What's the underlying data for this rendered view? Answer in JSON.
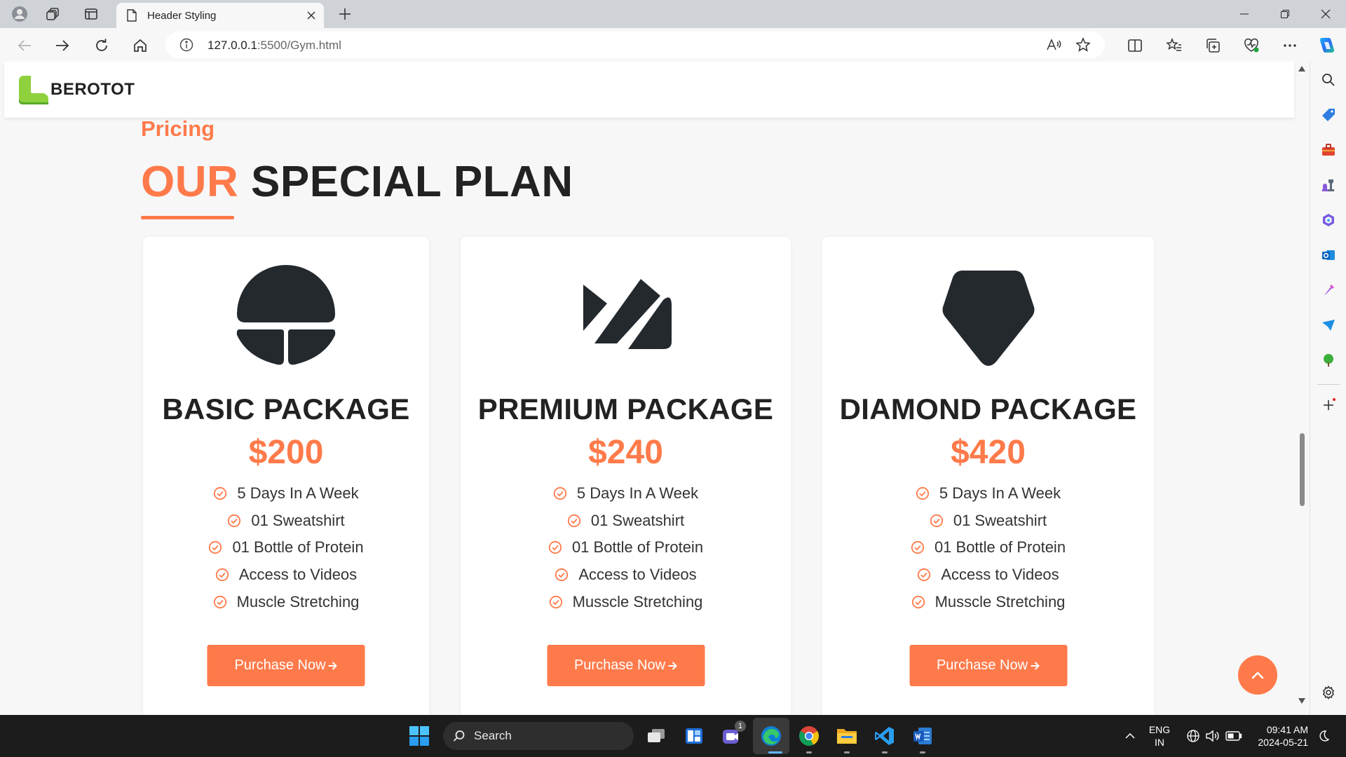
{
  "browser": {
    "tab_title": "Header Styling",
    "url_host": "127.0.0.1",
    "url_path": ":5500/Gym.html"
  },
  "site": {
    "logo_text": "BEROTOT",
    "section_subtitle": "Pricing",
    "section_title_accent": "OUR",
    "section_title_rest": "SPECIAL PLAN"
  },
  "plans": [
    {
      "name": "BASIC PACKAGE",
      "price": "$200",
      "icon": "basic-plan-icon",
      "features": [
        "5 Days In A Week",
        "01 Sweatshirt",
        "01 Bottle of Protein",
        "Access to Videos",
        "Muscle Stretching"
      ],
      "button": "Purchase Now"
    },
    {
      "name": "PREMIUM PACKAGE",
      "price": "$240",
      "icon": "premium-plan-icon",
      "features": [
        "5 Days In A Week",
        "01 Sweatshirt",
        "01 Bottle of Protein",
        "Access to Videos",
        "Musscle Stretching"
      ],
      "button": "Purchase Now"
    },
    {
      "name": "DIAMOND PACKAGE",
      "price": "$420",
      "icon": "diamond-plan-icon",
      "features": [
        "5 Days In A Week",
        "01 Sweatshirt",
        "01 Bottle of Protein",
        "Access to Videos",
        "Musscle Stretching"
      ],
      "button": "Purchase Now"
    }
  ],
  "taskbar": {
    "search_label": "Search",
    "chat_badge": "1",
    "lang_line1": "ENG",
    "lang_line2": "IN",
    "time": "09:41 AM",
    "date": "2024-05-21"
  },
  "colors": {
    "accent": "#ff7a4a",
    "text_dark": "#222222",
    "page_bg": "#f7f7f7",
    "logo_green": "#8fd13c"
  }
}
